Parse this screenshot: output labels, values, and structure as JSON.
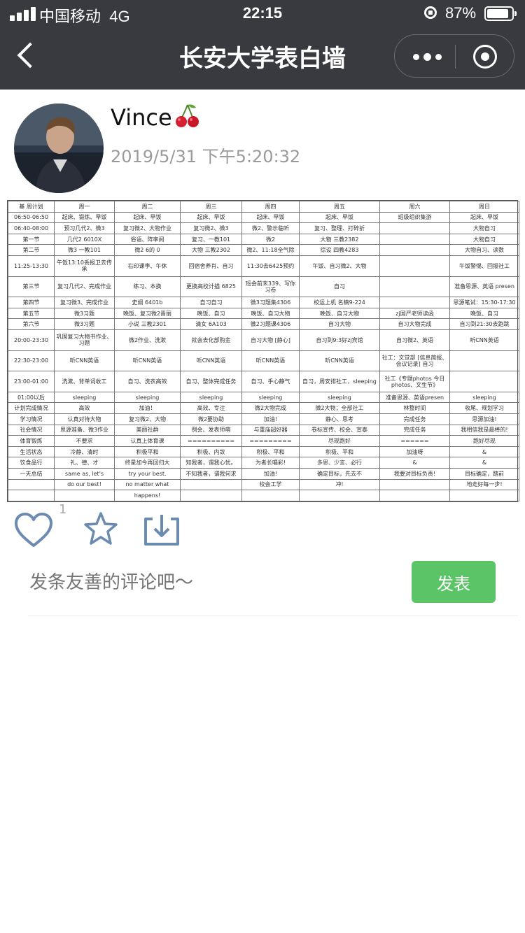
{
  "status_bar": {
    "carrier": "中国移动",
    "network": "4G",
    "time": "22:15",
    "battery_percent": "87%",
    "battery_level": 0.87
  },
  "nav": {
    "title": "长安大学表白墙",
    "back_icon": "chevron-left-icon",
    "more_icon": "more-dots-icon",
    "close_icon": "target-circle-icon"
  },
  "post": {
    "author": "Vince",
    "author_emoji_icon": "cherry-icon",
    "timestamp": "2019/5/31 下午5:20:32",
    "like_count": "1"
  },
  "schedule": {
    "rows": [
      [
        "基  周计划",
        "周一",
        "周二",
        "周三",
        "周四",
        "周五",
        "周六",
        "周日"
      ],
      [
        "06:50-06:50",
        "起床、锻炼、早饭",
        "起床、早饭",
        "起床、早饭",
        "起床、早饭",
        "起床、早饭",
        "班级组织集游",
        "起床、早饭"
      ],
      [
        "06:40-08:00",
        "预习几代2、微3",
        "复习微2、大物作业",
        "复习微2、微3",
        "微2、警示临听",
        "复习、整理、打碎折",
        "",
        "大物自习"
      ],
      [
        "第一节",
        "几代2 6010X",
        "俗语、阵率阅",
        "复习、一教101",
        "微2",
        "大物  三教2382",
        "",
        "大物自习"
      ],
      [
        "第二节",
        "微3  一教101",
        "微2  6的 0",
        "大物  三教2302",
        "微2、11:18全气除",
        "综设  四教4283",
        "",
        "大物自习、读数"
      ],
      [
        "11:25-13:30",
        "午饭13:10丢报卫去传承",
        "右印课李、午休",
        "回宿舍养肖、自习",
        "11:30去6425预约 ",
        "午饭、自习微2、大物",
        "",
        "午饭警惕、回报社工"
      ],
      [
        "第三节",
        "复习几代2、完成作业",
        "练习、本换",
        "更换高校计描 6825",
        "班会前末339、写你习卷",
        "自习",
        "",
        "准备思源、英语 presen"
      ],
      [
        "第四节",
        "复习微3、完成作业",
        "史纲   6401b",
        "自习自习",
        "微3习题集4306",
        "校运上机  名楠9-224",
        "",
        "思源笔试：15:30-17:30"
      ],
      [
        "第五节",
        "微3习题",
        "晚饭、复习微2晋丽",
        "晚饭、自习",
        "晚饭、自习大物",
        "晚饭、自习大物",
        "zj国严老师读函",
        "晚饭、自习"
      ],
      [
        "第六节",
        "微3习题",
        "小说 三教2301",
        "清女 6A103",
        "微2习题课4306",
        "自习大物",
        "自习大物完成",
        "自习到21:30去跑跳"
      ],
      [
        "20:00-23:30",
        "巩固复习大物书作业、习题",
        "微2作业、洗漱",
        "就会去化部购金",
        "自习大物 [静心]",
        "自习到9:3好zj宾馆",
        "自习微2、英语",
        "听CNN英语"
      ],
      [
        "22:30-23:00",
        "听CNN英语",
        "听CNN英语",
        "听CNN英语",
        "听CNN英语",
        "听CNN英语",
        "社工：文觉部 [信息简报、会议记录] 自习",
        ""
      ],
      [
        "23:00-01:00",
        "洗漱、背单词收工",
        "自习、洗衣高效",
        "自习、整体完成任务",
        "自习、手心静气",
        "自习，周安排社工，sleeping",
        "社工《专题photos 今日 photos、文生节》",
        ""
      ],
      [
        "01:00以后",
        "sleeping",
        "sleeping",
        "sleeping",
        "sleeping",
        "sleeping",
        "准备思源、英语presen",
        "sleeping"
      ],
      [
        "计划完成情况",
        "高效",
        "加油！",
        "高效、专注",
        "微2大物完成",
        "微2大物；全部社工",
        "林整时间",
        "收尾、规划学习"
      ],
      [
        "学习情况",
        "认真对待大物",
        "复习微2、大物",
        "微2要协助",
        "加油!",
        "静心、思考",
        "完成任务",
        "思源加油!"
      ],
      [
        "社会情况",
        "思源准备、微3作业",
        "美丽社群",
        "例会、发表师萌",
        "与重庙超好器",
        "卷标宣传、校会、宣泰",
        "完成任务",
        "我相信我是最棒的!"
      ],
      [
        "体育锻炼",
        "不要求",
        "认真上体育课",
        "==========",
        "=========",
        "尽现跑好",
        "======",
        "跑好尽现"
      ],
      [
        "生活状态",
        "冷静、清时",
        "积极平和",
        "积极、内敛",
        "积极、平和",
        "积极、平和",
        "加油呀",
        "&"
      ],
      [
        "饮食品行",
        "礼、德、才",
        "终星加今再回归大",
        "知我者，谓我心忧。",
        "为者长唱彩!",
        "多思、少言、必行",
        "&",
        "&"
      ],
      [
        "一天总结",
        "same as, let's",
        "try your best.",
        "不知我者，谓我何求",
        "加油!",
        "确定目标，先去不",
        "我要对目标负责!",
        "目标确定，踏前"
      ],
      [
        "",
        "do our best!",
        "no matter what",
        "",
        "校会工学",
        "冲!",
        "",
        "地走好每一步!"
      ],
      [
        "",
        "",
        "happens!",
        "",
        "",
        "",
        "",
        ""
      ]
    ]
  },
  "comment": {
    "placeholder": "发条友善的评论吧～",
    "submit_label": "发表"
  },
  "colors": {
    "nav_bg": "#393a3f",
    "accent_green": "#5ac467",
    "icon_blue": "#6b8bb0"
  }
}
